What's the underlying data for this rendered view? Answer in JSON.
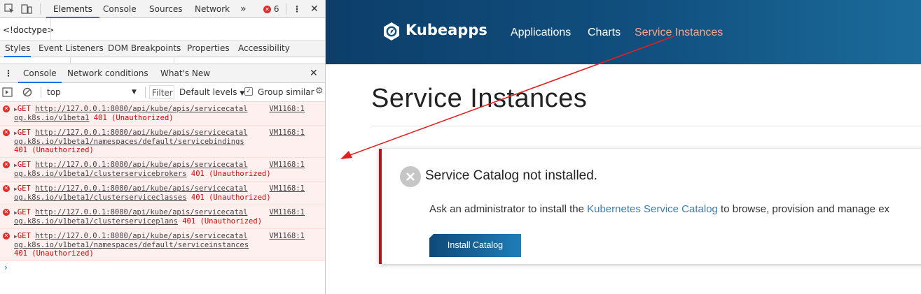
{
  "devtools": {
    "tabs": [
      "Elements",
      "Console",
      "Sources",
      "Network"
    ],
    "more_tabs_glyph": "»",
    "error_count": "6",
    "doctype": "<!doctype>",
    "subtabs": [
      "Styles",
      "Event Listeners",
      "DOM Breakpoints",
      "Properties",
      "Accessibility"
    ],
    "drawer_tabs": [
      "Console",
      "Network conditions",
      "What's New"
    ],
    "console_toolbar": {
      "context": "top",
      "filter_placeholder": "Filter",
      "levels": "Default levels",
      "group_similar": "Group similar"
    },
    "logs": [
      {
        "method": "GET",
        "url_line1": "http://127.0.0.1:8080/api/kube/apis/servicecatal",
        "url_line2": "og.k8s.io/v1beta1",
        "status": "401 (Unauthorized)",
        "status_wrap": false,
        "source": "VM1168:1"
      },
      {
        "method": "GET",
        "url_line1": "http://127.0.0.1:8080/api/kube/apis/servicecatal",
        "url_line2": "og.k8s.io/v1beta1/namespaces/default/servicebindings",
        "status": "401 (Unauthorized)",
        "status_wrap": true,
        "source": "VM1168:1"
      },
      {
        "method": "GET",
        "url_line1": "http://127.0.0.1:8080/api/kube/apis/servicecatal",
        "url_line2": "og.k8s.io/v1beta1/clusterservicebrokers",
        "status": "401 (Unauthorized)",
        "status_wrap": false,
        "source": "VM1168:1"
      },
      {
        "method": "GET",
        "url_line1": "http://127.0.0.1:8080/api/kube/apis/servicecatal",
        "url_line2": "og.k8s.io/v1beta1/clusterserviceclasses",
        "status": "401 (Unauthorized)",
        "status_wrap": false,
        "source": "VM1168:1"
      },
      {
        "method": "GET",
        "url_line1": "http://127.0.0.1:8080/api/kube/apis/servicecatal",
        "url_line2": "og.k8s.io/v1beta1/clusterserviceplans",
        "status": "401 (Unauthorized)",
        "status_wrap": false,
        "source": "VM1168:1"
      },
      {
        "method": "GET",
        "url_line1": "http://127.0.0.1:8080/api/kube/apis/servicecatal",
        "url_line2": "og.k8s.io/v1beta1/namespaces/default/serviceinstances",
        "status": "401 (Unauthorized)",
        "status_wrap": true,
        "source": "VM1168:1"
      }
    ],
    "prompt_glyph": "›"
  },
  "app": {
    "brand": "Kubeapps",
    "nav": [
      "Applications",
      "Charts",
      "Service Instances"
    ],
    "active_nav": "Service Instances",
    "page_title": "Service Instances",
    "alert": {
      "title": "Service Catalog not installed.",
      "body_prefix": "Ask an administrator to install the ",
      "link_text": "Kubernetes Service Catalog",
      "body_suffix": " to browse, provision and manage ex",
      "button": "Install Catalog"
    }
  },
  "colors": {
    "header_start": "#0d3e6a",
    "header_end": "#1b6b9a",
    "active_nav": "#f6a98f",
    "alert_border": "#b0161b",
    "error_text": "#dd0000",
    "annotation_arrow": "#e02020"
  }
}
